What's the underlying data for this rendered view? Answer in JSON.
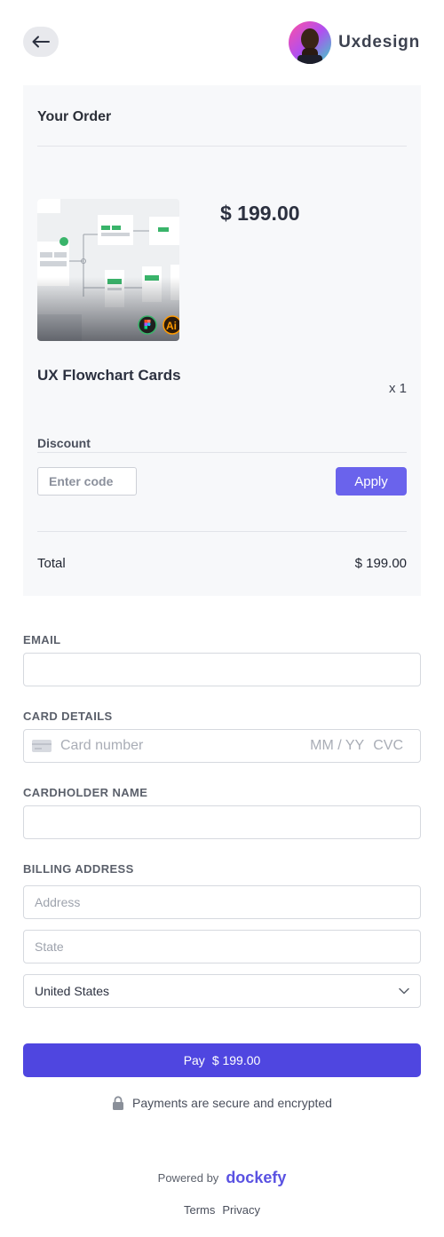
{
  "header": {
    "back_icon": "arrow-left-icon",
    "brand_name": "Uxdesign"
  },
  "order": {
    "title": "Your Order",
    "product_name": "UX Flowchart Cards",
    "price": "$ 199.00",
    "quantity": "x 1",
    "discount": {
      "label": "Discount",
      "placeholder": "Enter code",
      "apply_label": "Apply"
    },
    "total_label": "Total",
    "total_value": "$ 199.00"
  },
  "form": {
    "email_label": "EMAIL",
    "card_label": "CARD DETAILS",
    "card_number_placeholder": "Card number",
    "card_expiry_placeholder": "MM / YY",
    "card_cvc_placeholder": "CVC",
    "cardholder_label": "CARDHOLDER NAME",
    "billing_label": "BILLING ADDRESS",
    "address_placeholder": "Address",
    "state_placeholder": "State",
    "country_value": "United States"
  },
  "pay": {
    "label": "Pay",
    "amount": "$ 199.00"
  },
  "secure_text": "Payments are secure and encrypted",
  "footer": {
    "powered_by": "Powered by",
    "brand": "dockefy",
    "terms": "Terms",
    "privacy": "Privacy"
  },
  "colors": {
    "accent": "#4f46e0",
    "apply": "#6a63ec",
    "card_bg": "#f7f8fa"
  }
}
